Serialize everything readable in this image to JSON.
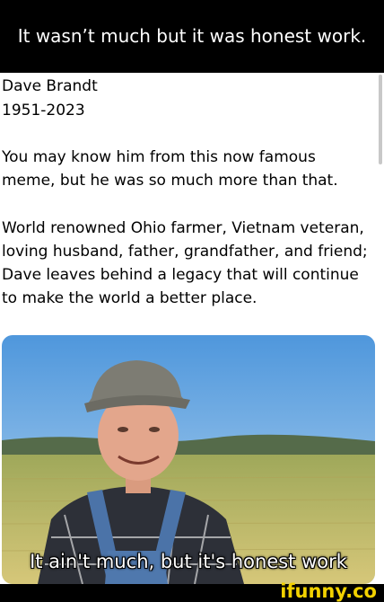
{
  "header": {
    "title": "It wasn’t much but it was honest work."
  },
  "post": {
    "name": "Dave Brandt",
    "years": "1951-2023",
    "paragraph1": [
      "You may know him from this now famous",
      "meme, but he was so much more than that."
    ],
    "paragraph2": [
      "World renowned Ohio farmer, Vietnam veteran,",
      "loving husband, father, grandfather, and friend;",
      "Dave leaves behind a legacy that will continue",
      "to make the world a better place."
    ],
    "image": {
      "caption": "It ain't much, but it's honest work"
    }
  },
  "footer": {
    "watermark": "ifunny.co"
  },
  "colors": {
    "header_bg": "#000000",
    "watermark": "#f2d100",
    "sky": "#5aa3e2",
    "field": "#c8c06a"
  }
}
